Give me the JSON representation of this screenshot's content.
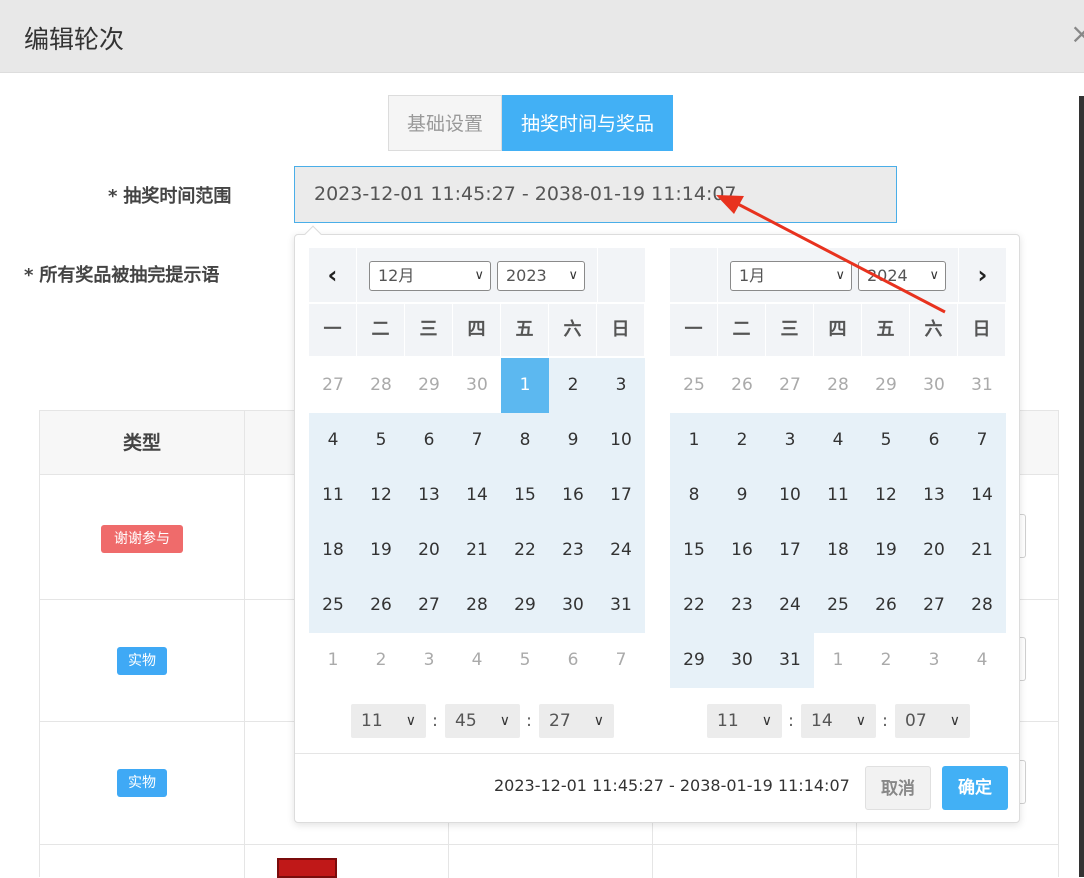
{
  "dialog": {
    "title": "编辑轮次",
    "close_glyph": "×"
  },
  "tabs": [
    {
      "label": "基础设置",
      "active": false
    },
    {
      "label": "抽奖时间与奖品",
      "active": true
    }
  ],
  "form": {
    "time_range_label": "抽奖时间范围",
    "exhausted_label": "所有奖品被抽完提示语",
    "required_mark": "*",
    "time_range_value": "2023-12-01 11:45:27 - 2038-01-19 11:14:07"
  },
  "table": {
    "header_type": "类型",
    "rows": [
      {
        "tag": "谢谢参与",
        "color": "#ef6b6b"
      },
      {
        "tag": "实物",
        "color": "#3fa9f5"
      },
      {
        "tag": "实物",
        "color": "#3fa9f5"
      }
    ]
  },
  "picker": {
    "weekdays": [
      "一",
      "二",
      "三",
      "四",
      "五",
      "六",
      "日"
    ],
    "left": {
      "month": "12月",
      "year": "2023",
      "days": [
        [
          "27",
          "28",
          "29",
          "30",
          "1",
          "2",
          "3"
        ],
        [
          "4",
          "5",
          "6",
          "7",
          "8",
          "9",
          "10"
        ],
        [
          "11",
          "12",
          "13",
          "14",
          "15",
          "16",
          "17"
        ],
        [
          "18",
          "19",
          "20",
          "21",
          "22",
          "23",
          "24"
        ],
        [
          "25",
          "26",
          "27",
          "28",
          "29",
          "30",
          "31"
        ],
        [
          "1",
          "2",
          "3",
          "4",
          "5",
          "6",
          "7"
        ]
      ],
      "time": {
        "hour": "11",
        "minute": "45",
        "second": "27"
      }
    },
    "right": {
      "month": "1月",
      "year": "2024",
      "days": [
        [
          "25",
          "26",
          "27",
          "28",
          "29",
          "30",
          "31"
        ],
        [
          "1",
          "2",
          "3",
          "4",
          "5",
          "6",
          "7"
        ],
        [
          "8",
          "9",
          "10",
          "11",
          "12",
          "13",
          "14"
        ],
        [
          "15",
          "16",
          "17",
          "18",
          "19",
          "20",
          "21"
        ],
        [
          "22",
          "23",
          "24",
          "25",
          "26",
          "27",
          "28"
        ],
        [
          "29",
          "30",
          "31",
          "1",
          "2",
          "3",
          "4"
        ]
      ],
      "time": {
        "hour": "11",
        "minute": "14",
        "second": "07"
      }
    },
    "footer_range": "2023-12-01 11:45:27 - 2038-01-19 11:14:07",
    "cancel_label": "取消",
    "ok_label": "确定"
  },
  "colors": {
    "accent": "#42b0f5",
    "range_bg": "#e7f1f8",
    "annotation_arrow": "#e8321e"
  }
}
